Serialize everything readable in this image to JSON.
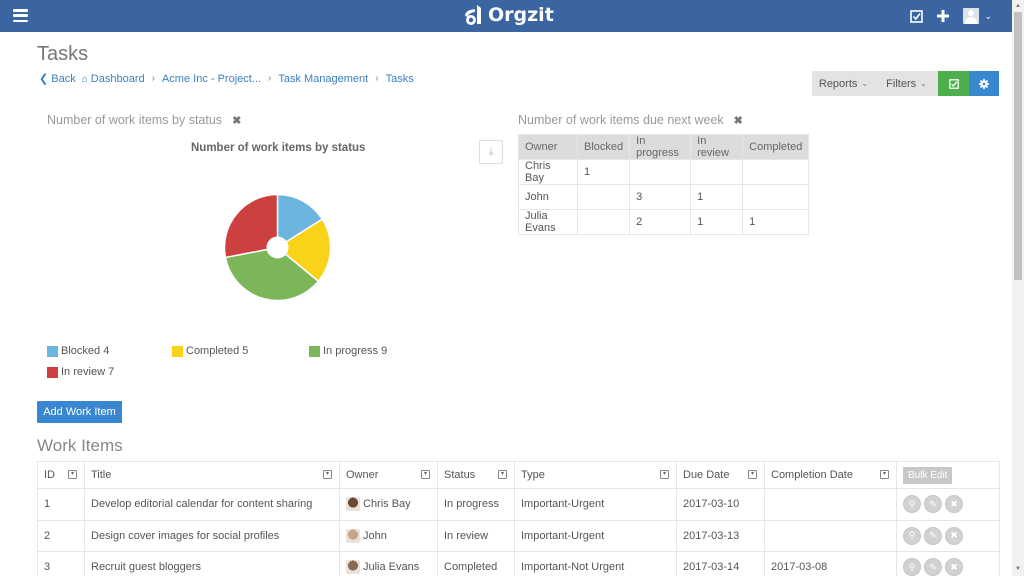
{
  "app": {
    "brand": "Orgzit",
    "menu_icon": "hamburger-icon",
    "top_icons": [
      "checkbox-icon",
      "plus-icon",
      "user-avatar-icon",
      "chevron-down-icon"
    ]
  },
  "page": {
    "title": "Tasks",
    "breadcrumb": {
      "back": "Back",
      "items": [
        "Dashboard",
        "Acme Inc - Project...",
        "Task Management",
        "Tasks"
      ]
    }
  },
  "action_bar": {
    "reports_label": "Reports",
    "filters_label": "Filters",
    "check_icon": "checkbox-icon",
    "gear_icon": "gear-icon",
    "colors": {
      "check": "#4cae4c",
      "gear": "#3a87d1"
    }
  },
  "widget_status": {
    "header": "Number of work items by status",
    "chart_title": "Number of work items by status",
    "download_icon": "download-icon"
  },
  "chart_data": {
    "type": "pie",
    "title": "Number of work items by status",
    "categories": [
      "Blocked",
      "Completed",
      "In progress",
      "In review"
    ],
    "values": [
      4,
      5,
      9,
      7
    ],
    "colors": [
      "#6bb5de",
      "#f9d21a",
      "#7cb65b",
      "#cc4040"
    ],
    "legend": [
      "Blocked 4",
      "Completed 5",
      "In progress 9",
      "In review 7"
    ],
    "legend_position": "bottom",
    "donut": true
  },
  "widget_due": {
    "header": "Number of work items due next week",
    "columns": [
      "Owner",
      "Blocked",
      "In progress",
      "In review",
      "Completed"
    ],
    "rows": [
      [
        "Chris Bay",
        "1",
        "",
        "",
        ""
      ],
      [
        "John",
        "",
        "3",
        "1",
        ""
      ],
      [
        "Julia Evans",
        "",
        "2",
        "1",
        "1"
      ]
    ]
  },
  "add_button": "Add Work Item",
  "work_items": {
    "title": "Work Items",
    "columns": [
      "ID",
      "Title",
      "Owner",
      "Status",
      "Type",
      "Due Date",
      "Completion Date"
    ],
    "bulk_edit": "Bulk Edit",
    "rows": [
      {
        "id": "1",
        "title": "Develop editorial calendar for content sharing",
        "owner": "Chris Bay",
        "status": "In progress",
        "type": "Important-Urgent",
        "due": "2017-03-10",
        "completed": ""
      },
      {
        "id": "2",
        "title": "Design cover images for social profiles",
        "owner": "John",
        "status": "In review",
        "type": "Important-Urgent",
        "due": "2017-03-13",
        "completed": ""
      },
      {
        "id": "3",
        "title": "Recruit guest bloggers",
        "owner": "Julia Evans",
        "status": "Completed",
        "type": "Important-Not Urgent",
        "due": "2017-03-14",
        "completed": "2017-03-08"
      }
    ],
    "row_action_icons": [
      "view-icon",
      "edit-icon",
      "delete-icon"
    ]
  }
}
